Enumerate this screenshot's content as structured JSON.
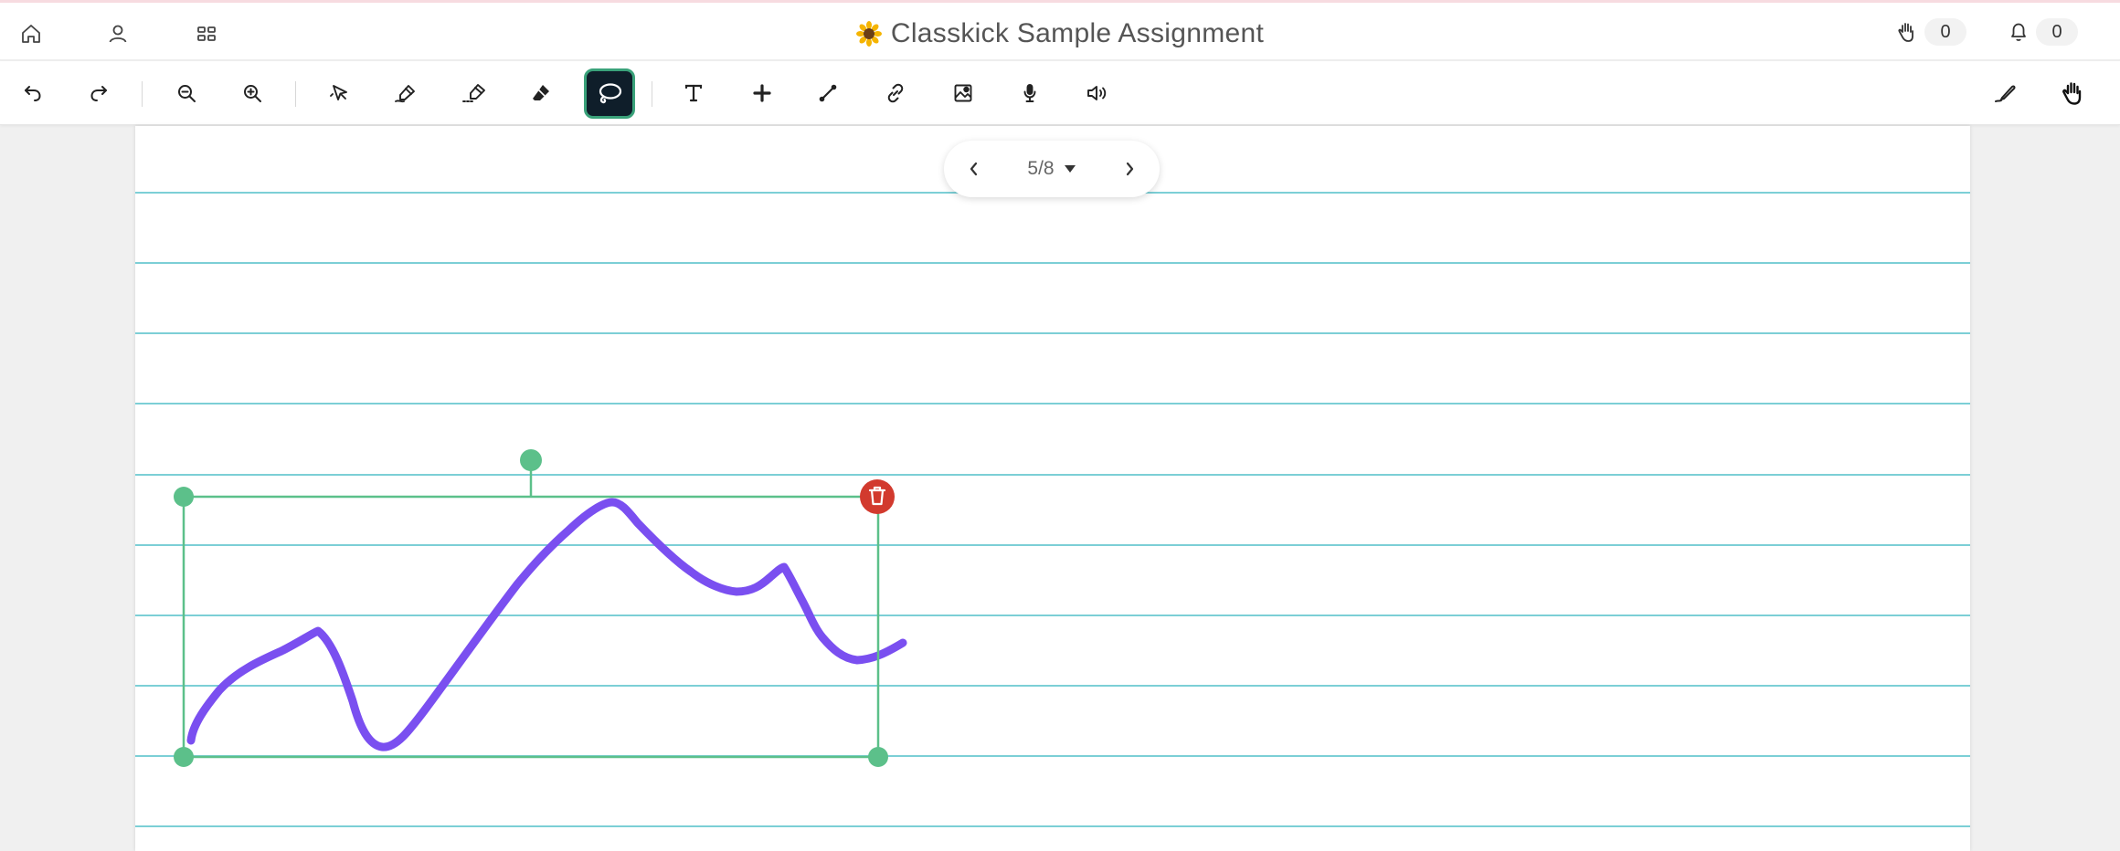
{
  "header": {
    "title": "Classkick Sample Assignment",
    "title_icon": "sunflower-icon",
    "nav": [
      "home-icon",
      "profile-icon",
      "grid-icon"
    ],
    "raised_hands_count": "0",
    "notifications_count": "0"
  },
  "toolbar": {
    "tools": [
      "undo-icon",
      "redo-icon",
      "zoom-out-icon",
      "zoom-in-icon",
      "pointer-icon",
      "pen-icon",
      "highlighter-icon",
      "eraser-icon",
      "lasso-icon",
      "text-icon",
      "plus-icon",
      "line-icon",
      "link-icon",
      "image-icon",
      "microphone-icon",
      "speaker-icon",
      "signature-icon",
      "hand-icon"
    ],
    "active_tool": "lasso-icon"
  },
  "pager": {
    "label": "5/8"
  },
  "colors": {
    "accent": "#3aa27a",
    "selection": "#5cc08a",
    "ink": "#7a4ff0",
    "delete": "#d23a2e",
    "rule": "#7ccfd6"
  }
}
